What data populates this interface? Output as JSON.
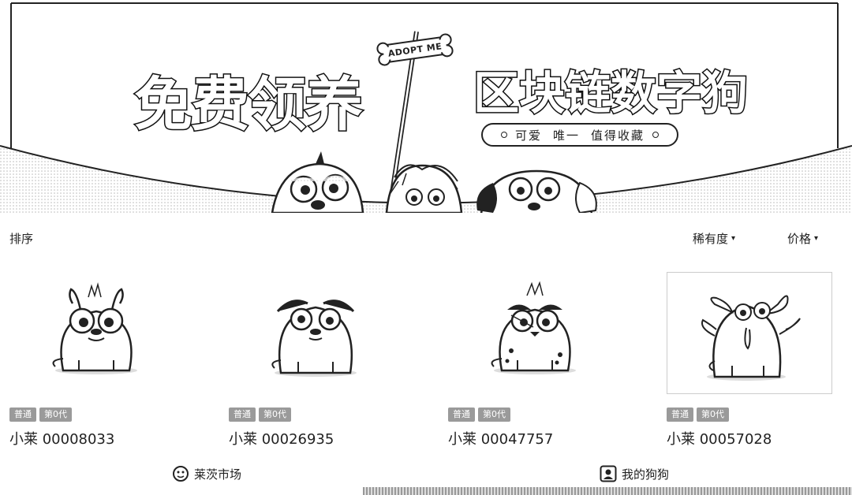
{
  "banner": {
    "sign_text": "ADOPT ME",
    "title_main": "免费领养",
    "title_sub": "区块链数字狗",
    "slogan": [
      "可爱",
      "唯一",
      "值得收藏"
    ]
  },
  "sort": {
    "label": "排序",
    "rarity": "稀有度",
    "price": "价格"
  },
  "dogs": [
    {
      "name": "小莱 00008033",
      "tags": [
        "普通",
        "第0代"
      ]
    },
    {
      "name": "小莱 00026935",
      "tags": [
        "普通",
        "第0代"
      ]
    },
    {
      "name": "小莱 00047757",
      "tags": [
        "普通",
        "第0代"
      ]
    },
    {
      "name": "小莱 00057028",
      "tags": [
        "普通",
        "第0代"
      ]
    }
  ],
  "nav": {
    "market": "莱茨市场",
    "mine": "我的狗狗"
  }
}
